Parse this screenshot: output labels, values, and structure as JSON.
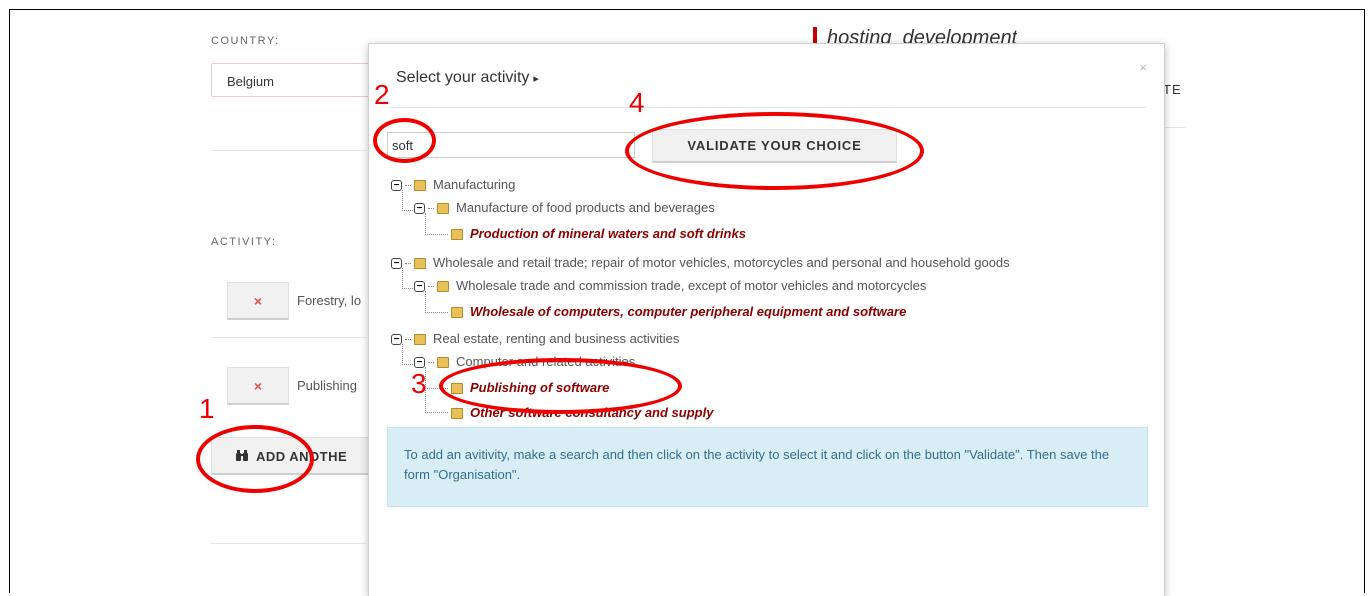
{
  "page": {
    "country_label": "COUNTRY:",
    "country_value": "Belgium",
    "activity_label": "ACTIVITY:",
    "hosting_text": "hosting_development",
    "te_stub": "TE",
    "activities": [
      {
        "remove": "×",
        "text": "Forestry, lo"
      },
      {
        "remove": "×",
        "text": "Publishing"
      }
    ],
    "add_button": "ADD ANOTHE",
    "add_icon": "binoculars-icon"
  },
  "modal": {
    "title": "Select your activity",
    "title_caret": "▸",
    "close": "×",
    "search_value": "soft",
    "validate_label": "VALIDATE YOUR CHOICE",
    "tree": [
      {
        "label": "Manufacturing"
      },
      {
        "label": "Manufacture of food products and beverages"
      },
      {
        "label": "Production of mineral waters and soft drinks"
      },
      {
        "label": "Wholesale and retail trade; repair of motor vehicles, motorcycles and personal and household goods"
      },
      {
        "label": "Wholesale trade and commission trade, except of motor vehicles and motorcycles"
      },
      {
        "label": "Wholesale of computers, computer peripheral equipment and software"
      },
      {
        "label": "Real estate, renting and business activities"
      },
      {
        "label": "Computer and related activities"
      },
      {
        "label": "Publishing of software"
      },
      {
        "label": "Other software consultancy and supply"
      }
    ],
    "info_text": "To add an avitivity, make a search and then click on the activity to select it and click on the button \"Validate\". Then save the form \"Organisation\"."
  },
  "annotations": {
    "n1": "1",
    "n2": "2",
    "n3": "3",
    "n4": "4",
    "color": "#ee0000"
  }
}
